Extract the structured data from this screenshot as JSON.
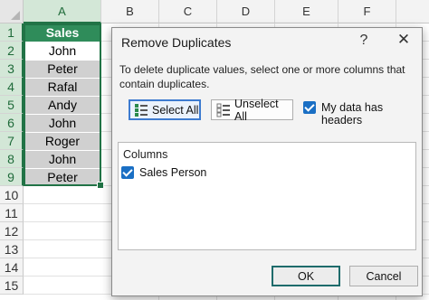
{
  "spreadsheet": {
    "columns": [
      "A",
      "B",
      "C",
      "D",
      "E",
      "F"
    ],
    "rows": [
      "1",
      "2",
      "3",
      "4",
      "5",
      "6",
      "7",
      "8",
      "9",
      "10",
      "11",
      "12",
      "13",
      "14",
      "15"
    ],
    "header_cell": "Sales Person",
    "data": [
      "John",
      "Peter",
      "Rafal",
      "Andy",
      "John",
      "Roger",
      "John",
      "Peter"
    ]
  },
  "dialog": {
    "title": "Remove Duplicates",
    "help": "?",
    "close": "✕",
    "instructions": "To delete duplicate values, select one or more columns that contain duplicates.",
    "select_all": "Select All",
    "unselect_all": "Unselect All",
    "my_data_has_headers": "My data has headers",
    "list_header": "Columns",
    "column_item": "Sales Person",
    "ok": "OK",
    "cancel": "Cancel"
  }
}
